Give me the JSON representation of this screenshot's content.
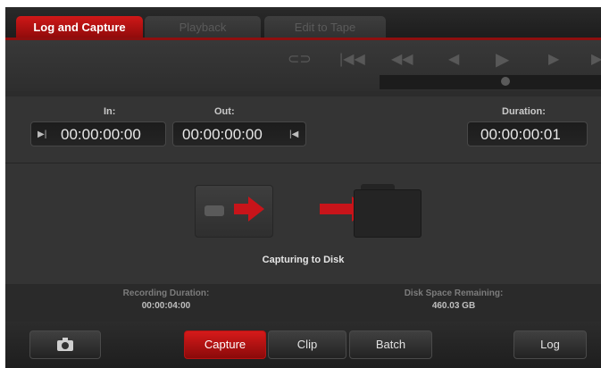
{
  "tabs": [
    {
      "label": "Log and Capture",
      "active": true
    },
    {
      "label": "Playback",
      "active": false
    },
    {
      "label": "Edit to Tape",
      "active": false
    }
  ],
  "timecode": {
    "in_label": "In:",
    "in_value": "00:00:00:00",
    "out_label": "Out:",
    "out_value": "00:00:00:00",
    "duration_label": "Duration:",
    "duration_value": "00:00:00:01"
  },
  "status": {
    "capture_text": "Capturing to Disk",
    "recording_label": "Recording Duration:",
    "recording_value": "00:00:04:00",
    "disk_label": "Disk Space Remaining:",
    "disk_value": "460.03 GB"
  },
  "bottom": {
    "capture_label": "Capture",
    "clip_label": "Clip",
    "batch_label": "Batch",
    "log_label": "Log"
  },
  "colors": {
    "accent_red": "#c81414",
    "panel": "#343434",
    "background": "#2c2c2c"
  }
}
